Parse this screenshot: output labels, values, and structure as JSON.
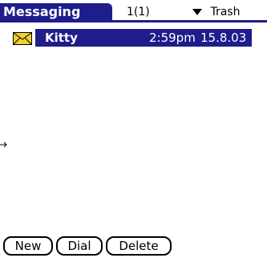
{
  "header": {
    "title": "Messaging",
    "counter": "1(1)",
    "category": "Trash"
  },
  "messages": [
    {
      "from": "Kitty",
      "time": "2:59pm",
      "date": "15.8.03",
      "icon": "envelope-icon",
      "selected": true
    }
  ],
  "buttons": {
    "new": "New",
    "dial": "Dial",
    "delete": "Delete"
  },
  "colors": {
    "accent": "#1f1d8b",
    "envelope": "#f1d02f"
  }
}
